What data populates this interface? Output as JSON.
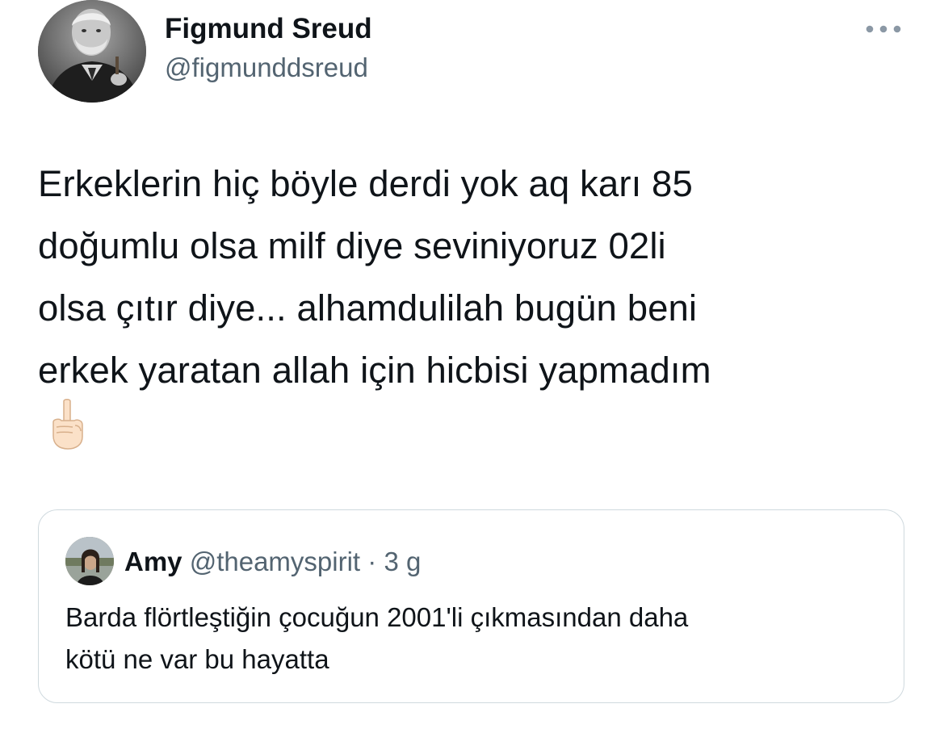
{
  "tweet": {
    "display_name": "Figmund Sreud",
    "handle": "@figmunddsreud",
    "text": "Erkeklerin hiç böyle derdi yok aq karı 85\ndoğumlu olsa milf diye seviniyoruz 02li\nolsa çıtır diye... alhamdulilah bugün beni\nerkek yaratan allah için hicbisi yapmadım",
    "emoji": "☝🏻",
    "more_icon": "ellipsis-icon"
  },
  "quote": {
    "display_name": "Amy",
    "handle": "@theamyspirit",
    "separator": "·",
    "time": "3 g",
    "text": "Barda flörtleştiğin çocuğun 2001'li çıkmasından daha\nkötü ne var bu hayatta"
  },
  "colors": {
    "text_primary": "#0f1419",
    "text_secondary": "#536471",
    "border": "#cfd9de",
    "background": "#ffffff"
  }
}
